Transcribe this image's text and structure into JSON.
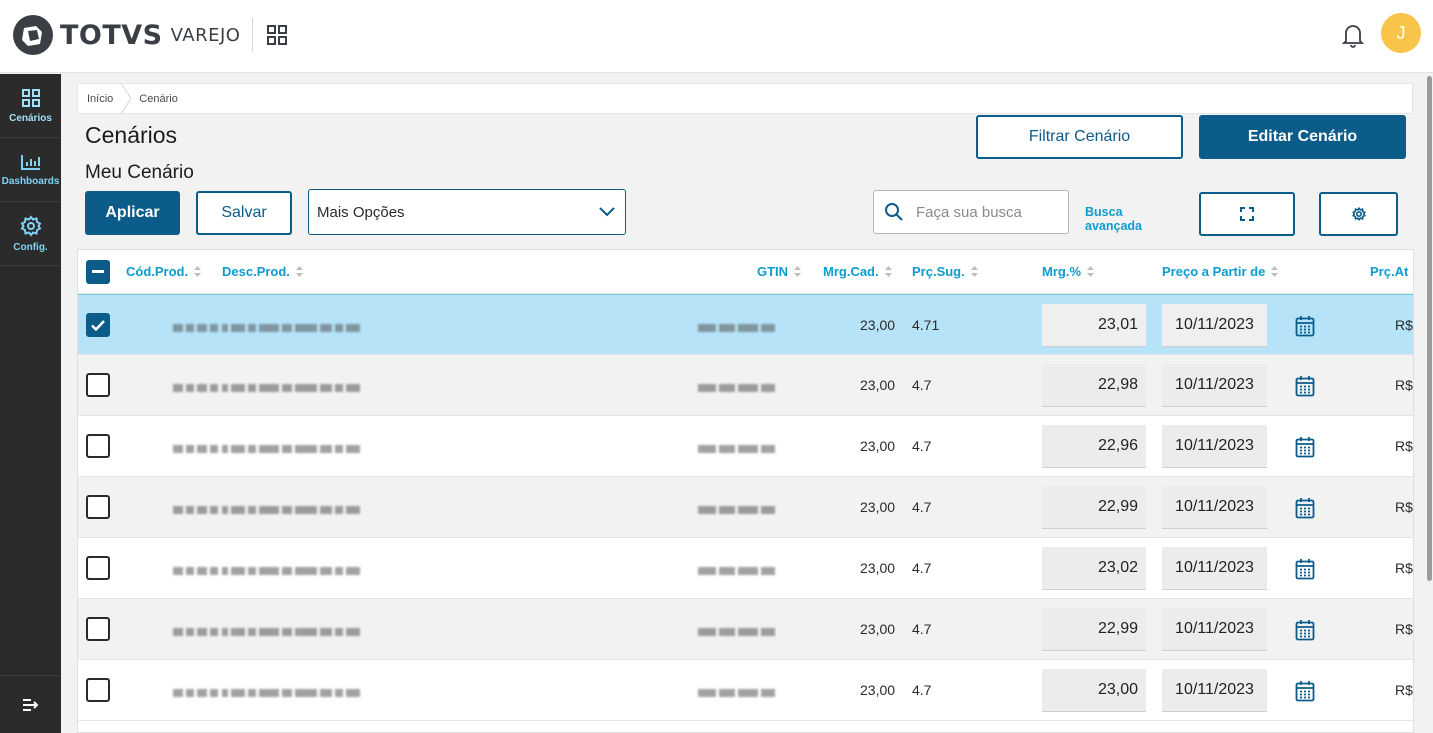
{
  "brand": {
    "name": "TOTVS",
    "product": "VAREJO",
    "accent": "#0c5c8a",
    "link": "#0c9ccf"
  },
  "user": {
    "avatar_letter": "J",
    "avatar_color": "#f8c54a"
  },
  "sidebar": {
    "items": [
      {
        "label": "Cenários",
        "icon": "grid-icon"
      },
      {
        "label": "Dashboards",
        "icon": "bar-chart-icon"
      },
      {
        "label": "Config.",
        "icon": "gear-icon"
      }
    ],
    "collapse_icon": "collapse-menu-icon"
  },
  "breadcrumb": [
    "Início",
    "Cenário"
  ],
  "page": {
    "title": "Cenários",
    "subtitle": "Meu Cenário"
  },
  "toolbar": {
    "filter_label": "Filtrar Cenário",
    "edit_label": "Editar Cenário",
    "apply_label": "Aplicar",
    "save_label": "Salvar",
    "options_label": "Mais Opções",
    "search_placeholder": "Faça sua busca",
    "advanced_search_line1": "Busca",
    "advanced_search_line2": "avançada"
  },
  "table": {
    "columns": [
      "Cód.Prod.",
      "Desc.Prod.",
      "GTIN",
      "Mrg.Cad.",
      "Prç.Sug.",
      "Mrg.%",
      "Preço a Partir de",
      "Prç.At"
    ],
    "rows": [
      {
        "selected": true,
        "mrg_cad": "23,00",
        "prc_sug": "4.71",
        "mrg_pct": "23,01",
        "date": "10/11/2023",
        "prc_at": "R$"
      },
      {
        "selected": false,
        "mrg_cad": "23,00",
        "prc_sug": "4.7",
        "mrg_pct": "22,98",
        "date": "10/11/2023",
        "prc_at": "R$"
      },
      {
        "selected": false,
        "mrg_cad": "23,00",
        "prc_sug": "4.7",
        "mrg_pct": "22,96",
        "date": "10/11/2023",
        "prc_at": "R$"
      },
      {
        "selected": false,
        "mrg_cad": "23,00",
        "prc_sug": "4.7",
        "mrg_pct": "22,99",
        "date": "10/11/2023",
        "prc_at": "R$"
      },
      {
        "selected": false,
        "mrg_cad": "23,00",
        "prc_sug": "4.7",
        "mrg_pct": "23,02",
        "date": "10/11/2023",
        "prc_at": "R$"
      },
      {
        "selected": false,
        "mrg_cad": "23,00",
        "prc_sug": "4.7",
        "mrg_pct": "22,99",
        "date": "10/11/2023",
        "prc_at": "R$"
      },
      {
        "selected": false,
        "mrg_cad": "23,00",
        "prc_sug": "4.7",
        "mrg_pct": "23,00",
        "date": "10/11/2023",
        "prc_at": "R$"
      }
    ]
  }
}
